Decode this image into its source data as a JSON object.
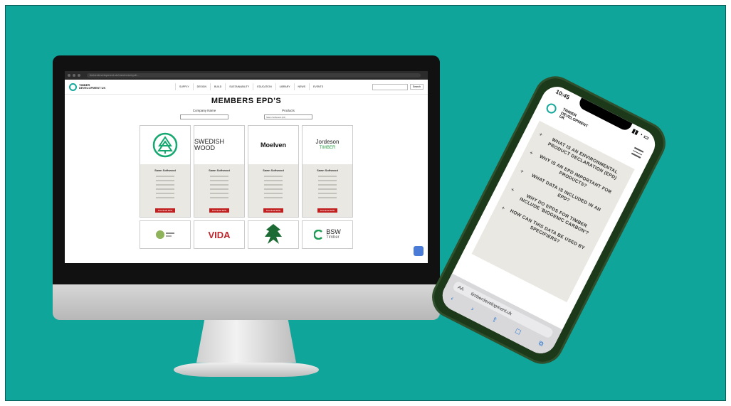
{
  "browser": {
    "url": "timberdevelopment.uk/members/epd/..."
  },
  "site": {
    "logo_text": "TIMBER DEVELOPMENT UK",
    "nav": [
      "SUPPLY",
      "DESIGN",
      "BUILD",
      "SUSTAINABILITY",
      "EDUCATION",
      "LIBRARY",
      "NEWS",
      "EVENTS"
    ],
    "search_button": "Search"
  },
  "page": {
    "title": "MEMBERS EPD'S",
    "filters": {
      "company_label": "Company Name",
      "products_label": "Products",
      "products_value": "Sawn Softwood (22)"
    }
  },
  "cards": [
    {
      "name": "Sawn Softwood",
      "download": "Download EPD"
    },
    {
      "name": "Sawn Softwood",
      "download": "Download EPD"
    },
    {
      "name": "Sawn Softwood",
      "download": "Download EPD"
    },
    {
      "name": "Sawn Softwood",
      "download": "Download EPD"
    }
  ],
  "logos": {
    "swedish": "SWEDISH WOOD",
    "moelven": "Moelven",
    "jordeson": "Jordeson",
    "jordeson_sub": "TIMBER",
    "vida": "VIDA",
    "bsw": "BSW",
    "bsw_sub": "Timber"
  },
  "phone": {
    "time": "10:45",
    "logo_text": "TIMBER DEVELOPMENT UK",
    "faq": [
      "WHAT IS AN ENVIRONMENTAL PRODUCT DECLARATION (EPD)",
      "WHY IS AN EPD IMPORTANT FOR PRODUCTS?",
      "WHAT DATA IS INCLUDED IN AN EPD?",
      "WHY DO EPDS FOR TIMBER INCLUDE 'BIOGENIC CARBON'?",
      "HOW CAN THIS DATA BE USED BY SPECIFIERS?"
    ],
    "aa": "AA",
    "url": "timberdevelopment.uk"
  }
}
